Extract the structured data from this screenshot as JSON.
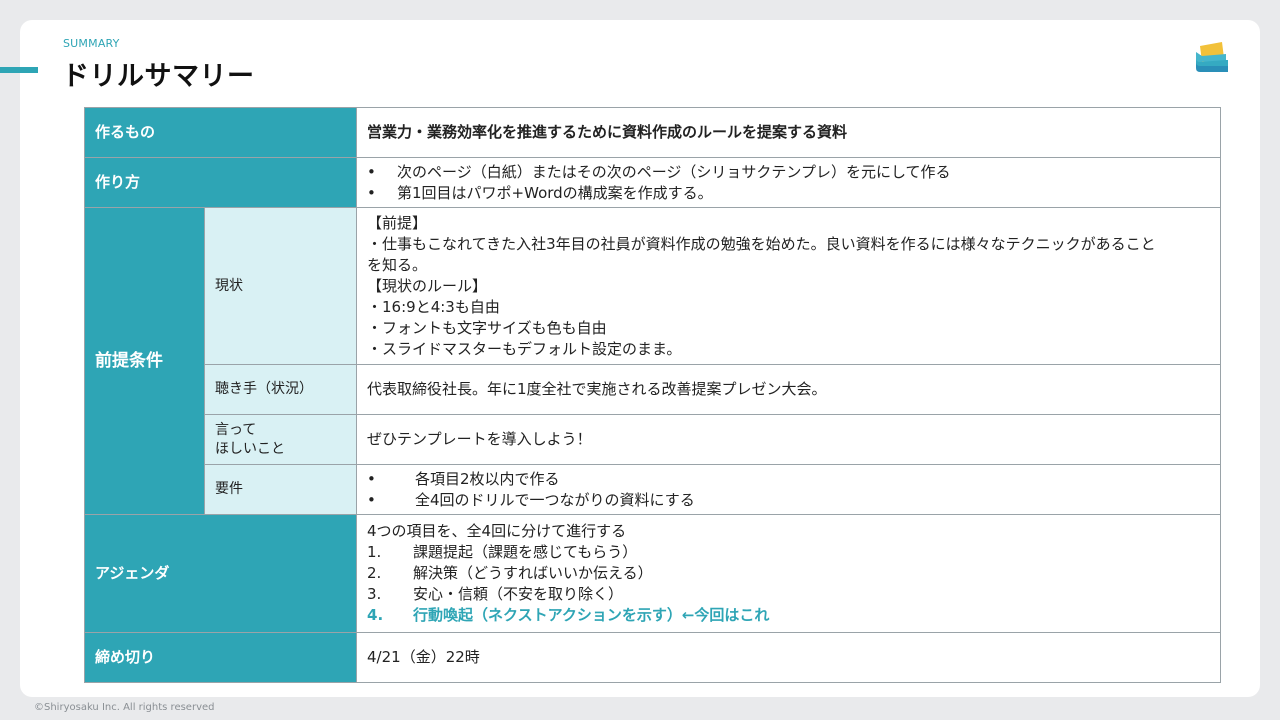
{
  "header": {
    "label": "SUMMARY",
    "title": "ドリルサマリー",
    "logo_icon": "layers-logo-icon",
    "accent_color": "#2ea5b5"
  },
  "table": {
    "row_make": {
      "label": "作るもの",
      "value": "営業力・業務効率化を推進するために資料作成のルールを提案する資料"
    },
    "row_how": {
      "label": "作り方",
      "bullets": [
        {
          "marker": "•",
          "text": "次のページ（白紙）またはその次のページ（シリョサクテンプレ）を元にして作る"
        },
        {
          "marker": "•",
          "text": "第1回目はパワポ+Wordの構成案を作成する。"
        }
      ]
    },
    "premise": {
      "label": "前提条件",
      "current": {
        "label": "現状",
        "lines": [
          "【前提】",
          "・仕事もこなれてきた入社3年目の社員が資料作成の勉強を始めた。良い資料を作るには様々なテクニックがあること",
          "を知る。",
          "【現状のルール】",
          "・16:9と4:3も自由",
          "・フォントも文字サイズも色も自由",
          "・スライドマスターもデフォルト設定のまま。"
        ]
      },
      "audience": {
        "label": "聴き手（状況）",
        "value": "代表取締役社長。年に1度全社で実施される改善提案プレゼン大会。"
      },
      "message": {
        "label_line1": "言って",
        "label_line2": "ほしいこと",
        "value": "ぜひテンプレートを導入しよう！"
      },
      "requirements": {
        "label": "要件",
        "bullets": [
          {
            "marker": "•",
            "text": "各項目2枚以内で作る"
          },
          {
            "marker": "•",
            "text": "全4回のドリルで一つながりの資料にする"
          }
        ]
      }
    },
    "agenda": {
      "label": "アジェンダ",
      "intro": "4つの項目を、全4回に分けて進行する",
      "items": [
        {
          "num": "1.",
          "text": "課題提起（課題を感じてもらう）"
        },
        {
          "num": "2.",
          "text": "解決策（どうすればいいか伝える）"
        },
        {
          "num": "3.",
          "text": "安心・信頼（不安を取り除く）"
        },
        {
          "num": "4.",
          "text": "行動喚起（ネクストアクションを示す）←今回はこれ"
        }
      ]
    },
    "deadline": {
      "label": "締め切り",
      "value": "4/21（金）22時"
    }
  },
  "footer": {
    "copyright": "©Shiryosaku Inc. All rights reserved"
  }
}
